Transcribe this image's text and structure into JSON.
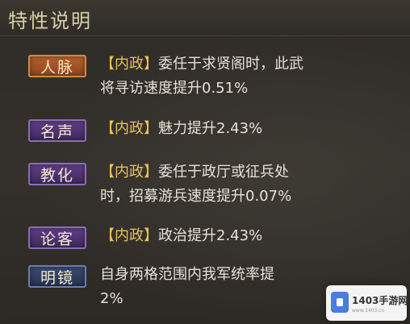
{
  "header": {
    "title": "特性说明"
  },
  "traits": [
    {
      "name": "人脉",
      "tag": "【内政】",
      "line1": "委任于求贤阁时，此武",
      "line2": "将寻访速度提升0.51%"
    },
    {
      "name": "名声",
      "tag": "【内政】",
      "line1": "魅力提升2.43%",
      "line2": ""
    },
    {
      "name": "教化",
      "tag": "【内政】",
      "line1": "委任于政厅或征兵处",
      "line2": "时，招募游兵速度提升0.07%"
    },
    {
      "name": "论客",
      "tag": "【内政】",
      "line1": "政治提升2.43%",
      "line2": ""
    },
    {
      "name": "明镜",
      "tag": "",
      "line1": "自身两格范围内我军统率提",
      "line2": "2%"
    }
  ],
  "watermark": {
    "text": "1403手游网",
    "sub": "www.1403.cn"
  }
}
